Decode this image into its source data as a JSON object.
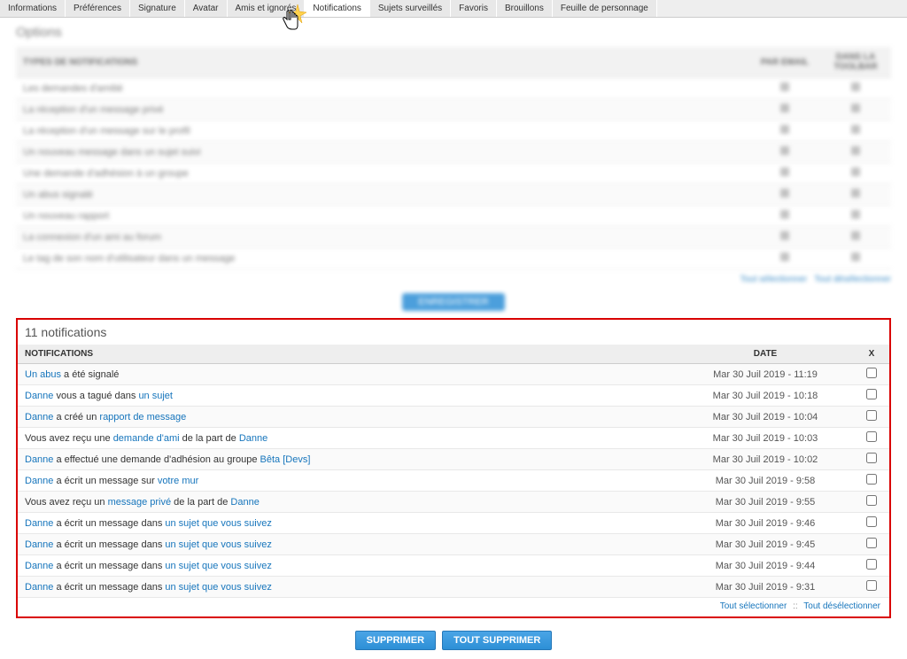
{
  "tabs": [
    {
      "label": "Informations"
    },
    {
      "label": "Préférences"
    },
    {
      "label": "Signature"
    },
    {
      "label": "Avatar"
    },
    {
      "label": "Amis et ignorés"
    },
    {
      "label": "Notifications",
      "active": true
    },
    {
      "label": "Sujets surveillés"
    },
    {
      "label": "Favoris"
    },
    {
      "label": "Brouillons"
    },
    {
      "label": "Feuille de personnage"
    }
  ],
  "blurred": {
    "heading": "Options",
    "th_type": "TYPES DE NOTIFICATIONS",
    "th_email": "PAR EMAIL",
    "th_toolbar": "DANS LA TOOLBAR",
    "rows": [
      "Les demandes d'amitié",
      "La réception d'un message privé",
      "La réception d'un message sur le profil",
      "Un nouveau message dans un sujet suivi",
      "Une demande d'adhésion à un groupe",
      "Un abus signalé",
      "Un nouveau rapport",
      "La connexion d'un ami au forum",
      "Le tag de son nom d'utilisateur dans un message"
    ],
    "save_btn": "ENREGISTRER",
    "sel_all": "Tout sélectionner",
    "desel_all": "Tout désélectionner"
  },
  "notifications": {
    "title": "11 notifications",
    "th_notif": "NOTIFICATIONS",
    "th_date": "DATE",
    "th_x": "X",
    "rows": [
      {
        "parts": [
          {
            "t": "Un abus",
            "l": 1
          },
          {
            "t": " a été signalé"
          }
        ],
        "date": "Mar 30 Juil 2019 - 11:19"
      },
      {
        "parts": [
          {
            "t": "Danne",
            "l": 1
          },
          {
            "t": " vous a tagué dans "
          },
          {
            "t": "un sujet",
            "l": 1
          }
        ],
        "date": "Mar 30 Juil 2019 - 10:18"
      },
      {
        "parts": [
          {
            "t": "Danne",
            "l": 1
          },
          {
            "t": " a créé un "
          },
          {
            "t": "rapport de message",
            "l": 1
          }
        ],
        "date": "Mar 30 Juil 2019 - 10:04"
      },
      {
        "parts": [
          {
            "t": "Vous avez reçu une "
          },
          {
            "t": "demande d'ami",
            "l": 1
          },
          {
            "t": " de la part de "
          },
          {
            "t": "Danne",
            "l": 1
          }
        ],
        "date": "Mar 30 Juil 2019 - 10:03"
      },
      {
        "parts": [
          {
            "t": "Danne",
            "l": 1
          },
          {
            "t": " a effectué une demande d'adhésion au groupe "
          },
          {
            "t": "Bêta [Devs]",
            "l": 1
          }
        ],
        "date": "Mar 30 Juil 2019 - 10:02"
      },
      {
        "parts": [
          {
            "t": "Danne",
            "l": 1
          },
          {
            "t": " a écrit un message sur "
          },
          {
            "t": "votre mur",
            "l": 1
          }
        ],
        "date": "Mar 30 Juil 2019 - 9:58"
      },
      {
        "parts": [
          {
            "t": "Vous avez reçu un "
          },
          {
            "t": "message privé",
            "l": 1
          },
          {
            "t": " de la part de "
          },
          {
            "t": "Danne",
            "l": 1
          }
        ],
        "date": "Mar 30 Juil 2019 - 9:55"
      },
      {
        "parts": [
          {
            "t": "Danne",
            "l": 1
          },
          {
            "t": " a écrit un message dans "
          },
          {
            "t": "un sujet que vous suivez",
            "l": 1
          }
        ],
        "date": "Mar 30 Juil 2019 - 9:46"
      },
      {
        "parts": [
          {
            "t": "Danne",
            "l": 1
          },
          {
            "t": " a écrit un message dans "
          },
          {
            "t": "un sujet que vous suivez",
            "l": 1
          }
        ],
        "date": "Mar 30 Juil 2019 - 9:45"
      },
      {
        "parts": [
          {
            "t": "Danne",
            "l": 1
          },
          {
            "t": " a écrit un message dans "
          },
          {
            "t": "un sujet que vous suivez",
            "l": 1
          }
        ],
        "date": "Mar 30 Juil 2019 - 9:44"
      },
      {
        "parts": [
          {
            "t": "Danne",
            "l": 1
          },
          {
            "t": " a écrit un message dans "
          },
          {
            "t": "un sujet que vous suivez",
            "l": 1
          }
        ],
        "date": "Mar 30 Juil 2019 - 9:31"
      }
    ],
    "sel_all": "Tout sélectionner",
    "desel_all": "Tout désélectionner",
    "sep": "::",
    "btn_delete": "SUPPRIMER",
    "btn_delete_all": "TOUT SUPPRIMER"
  }
}
